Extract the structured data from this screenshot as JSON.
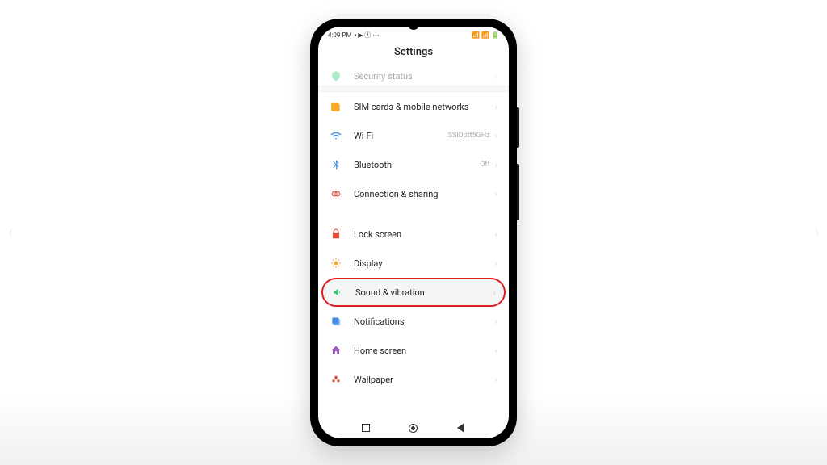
{
  "status": {
    "time": "4:09 PM",
    "icons_left": "▪ ▶ ⓕ ⋯",
    "icons_right": "📶 📶 🔋"
  },
  "header": {
    "title": "Settings"
  },
  "partial_item": {
    "label": "Security status"
  },
  "groups": [
    {
      "items": [
        {
          "icon": "sim-icon",
          "color": "#f5a623",
          "label": "SIM cards & mobile networks",
          "value": ""
        },
        {
          "icon": "wifi-icon",
          "color": "#4a90e2",
          "label": "Wi-Fi",
          "value": "SSIDptt5GHz"
        },
        {
          "icon": "bluetooth-icon",
          "color": "#4a90e2",
          "label": "Bluetooth",
          "value": "Off"
        },
        {
          "icon": "connection-icon",
          "color": "#e74c3c",
          "label": "Connection & sharing",
          "value": ""
        }
      ]
    },
    {
      "items": [
        {
          "icon": "lock-icon",
          "color": "#e74c3c",
          "label": "Lock screen",
          "value": ""
        },
        {
          "icon": "display-icon",
          "color": "#f5a623",
          "label": "Display",
          "value": ""
        },
        {
          "icon": "sound-icon",
          "color": "#2ecc71",
          "label": "Sound & vibration",
          "value": "",
          "highlighted": true
        },
        {
          "icon": "notifications-icon",
          "color": "#4a90e2",
          "label": "Notifications",
          "value": ""
        },
        {
          "icon": "home-icon",
          "color": "#9b59b6",
          "label": "Home screen",
          "value": ""
        },
        {
          "icon": "wallpaper-icon",
          "color": "#e74c3c",
          "label": "Wallpaper",
          "value": ""
        }
      ]
    }
  ]
}
